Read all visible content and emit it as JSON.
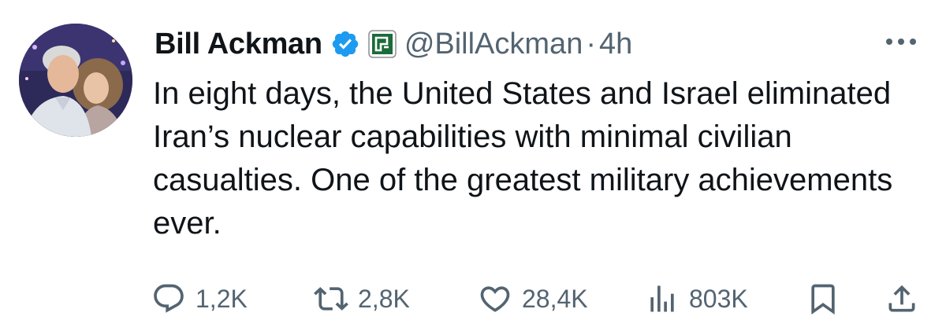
{
  "tweet": {
    "author": {
      "display_name": "Bill Ackman",
      "handle": "@BillAckman",
      "verified_icon": "verified-badge-icon",
      "affiliate_icon": "pershing-square-affiliate-icon"
    },
    "separator": "·",
    "time": "4h",
    "more_icon": "more-options-icon",
    "text": "In eight days, the United States and Israel eliminated Iran’s nuclear capabilities with minimal civilian casualties. One of the greatest military achievements ever."
  },
  "actions": {
    "reply": {
      "icon": "reply-icon",
      "count": "1,2K"
    },
    "repost": {
      "icon": "repost-icon",
      "count": "2,8K"
    },
    "like": {
      "icon": "heart-icon",
      "count": "28,4K"
    },
    "views": {
      "icon": "views-icon",
      "count": "803K"
    },
    "bookmark": {
      "icon": "bookmark-icon"
    },
    "share": {
      "icon": "share-icon"
    }
  },
  "colors": {
    "text_primary": "#0f1419",
    "text_secondary": "#536471",
    "verified_blue": "#1d9bf0",
    "affiliate_green": "#1c6b3a"
  }
}
